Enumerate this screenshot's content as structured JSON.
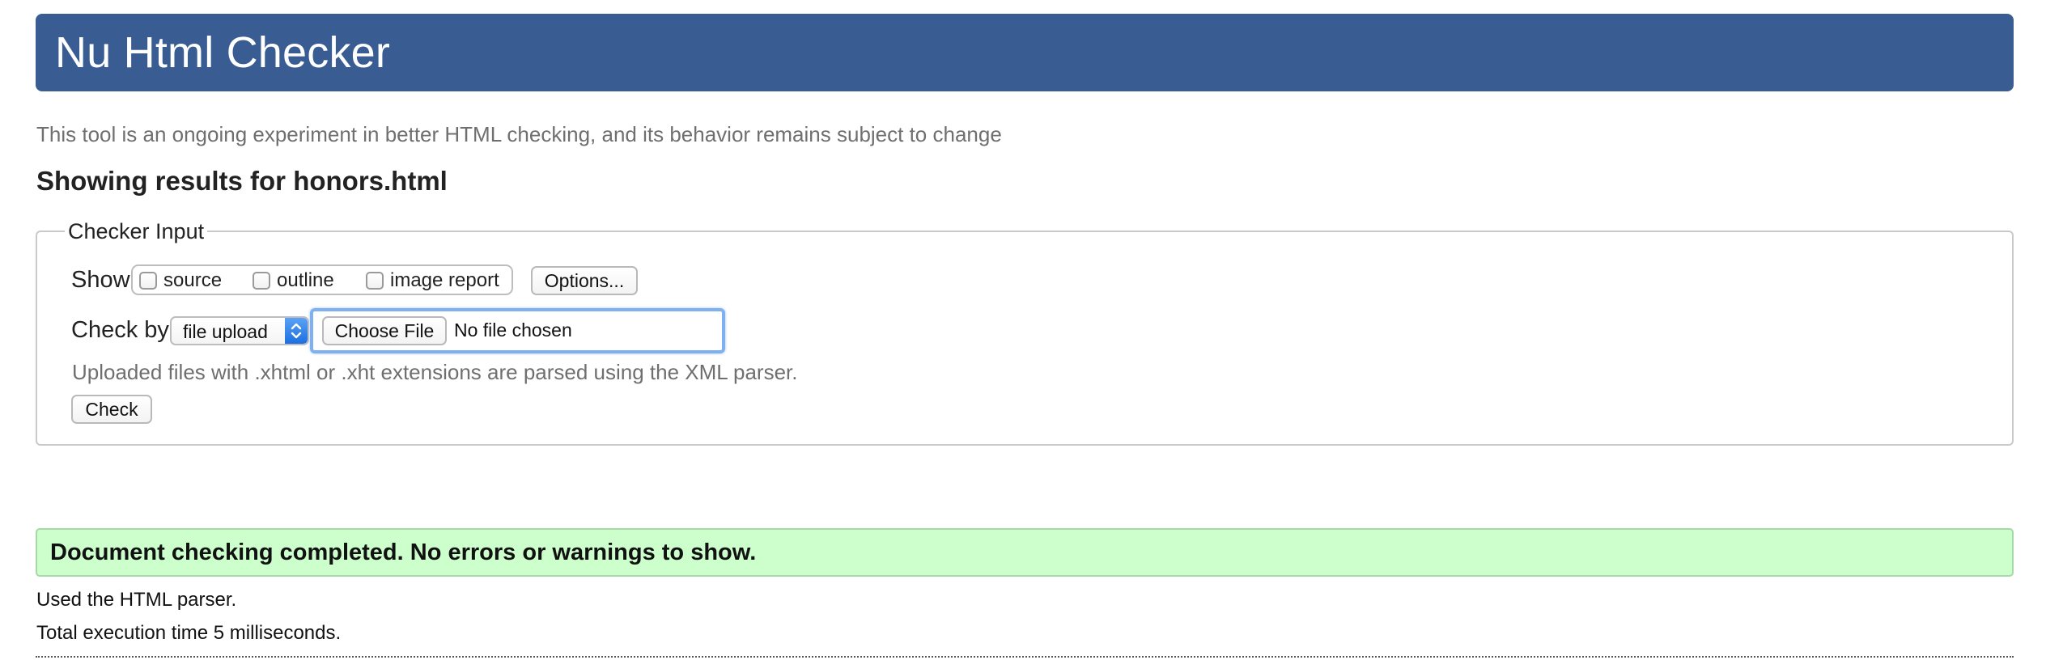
{
  "header": {
    "title": "Nu Html Checker"
  },
  "intro_text": "This tool is an ongoing experiment in better HTML checking, and its behavior remains subject to change",
  "results_heading": "Showing results for honors.html",
  "checker_input": {
    "legend": "Checker Input",
    "show_label": "Show",
    "show_options": [
      {
        "label": "source",
        "checked": false
      },
      {
        "label": "outline",
        "checked": false
      },
      {
        "label": "image report",
        "checked": false
      }
    ],
    "options_button": "Options...",
    "check_by_label": "Check by",
    "check_by_selected": "file upload",
    "choose_file_button": "Choose File",
    "file_status": "No file chosen",
    "help_text": "Uploaded files with .xhtml or .xht extensions are parsed using the XML parser.",
    "check_button": "Check"
  },
  "success_message": "Document checking completed. No errors or warnings to show.",
  "parser_info": "Used the HTML parser.",
  "execution_time": "Total execution time 5 milliseconds.",
  "colors": {
    "banner": "#395d93",
    "success_background": "#ccffcc",
    "focus_ring": "#7fb1f1",
    "muted_text": "#6f6f6f"
  }
}
